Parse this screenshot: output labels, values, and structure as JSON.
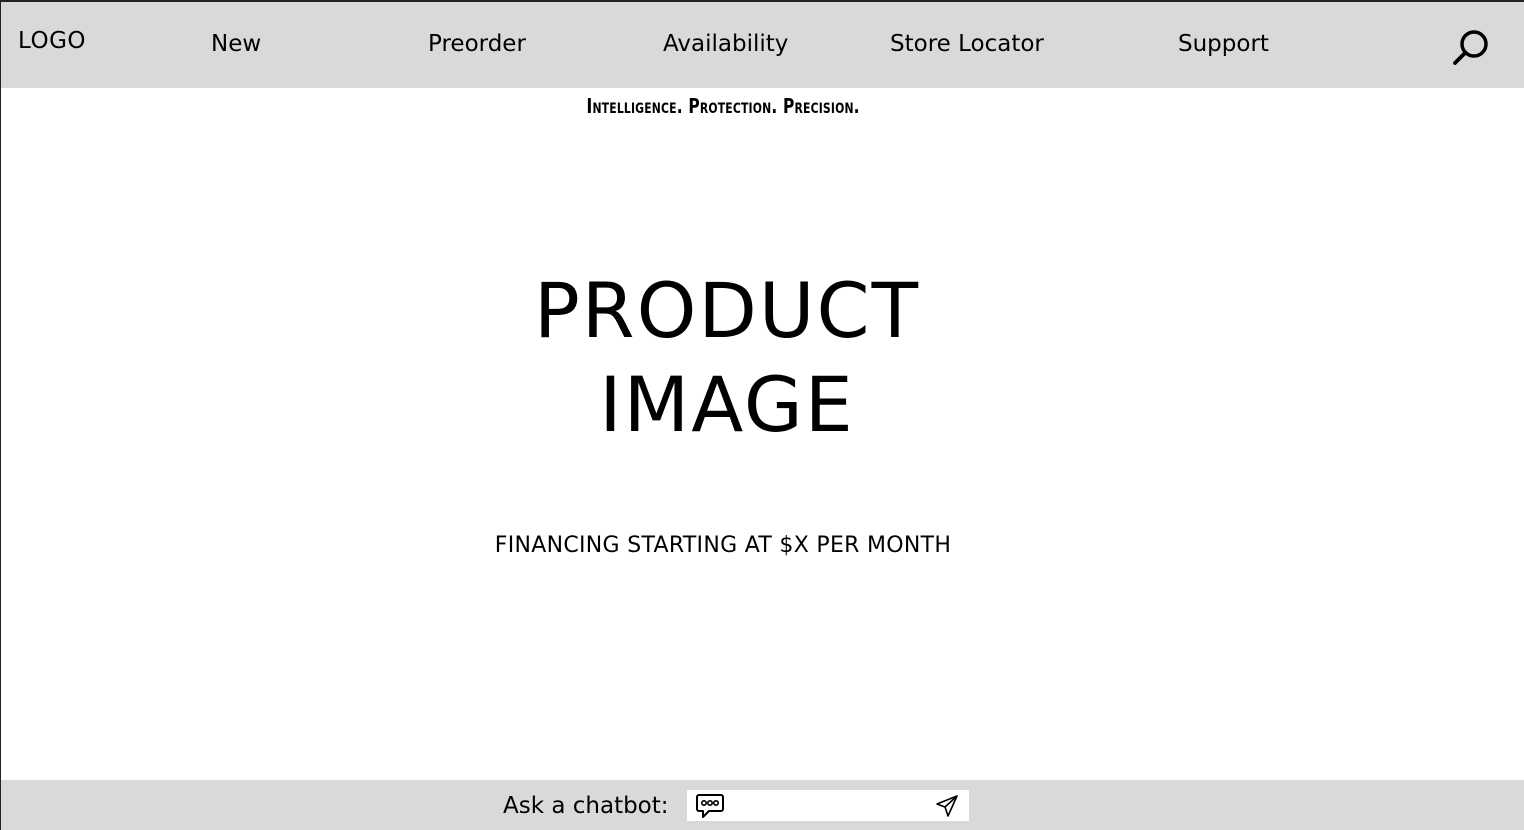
{
  "header": {
    "logo": "LOGO",
    "nav": [
      {
        "label": "New"
      },
      {
        "label": "Preorder"
      },
      {
        "label": "Availability"
      },
      {
        "label": "Store Locator"
      },
      {
        "label": "Support"
      }
    ],
    "search_icon": "search-icon"
  },
  "hero": {
    "tagline": "Intelligence. Protection. Precision.",
    "product_image_line1": "PRODUCT",
    "product_image_line2": "IMAGE",
    "financing": "FINANCING STARTING AT $X PER MONTH"
  },
  "chatbar": {
    "label": "Ask a chatbot:",
    "input_value": "",
    "chat_icon": "chat-bubble-icon",
    "send_icon": "send-icon"
  },
  "colors": {
    "bar_background": "#d9d9d9",
    "page_background": "#ffffff",
    "text": "#000000"
  }
}
